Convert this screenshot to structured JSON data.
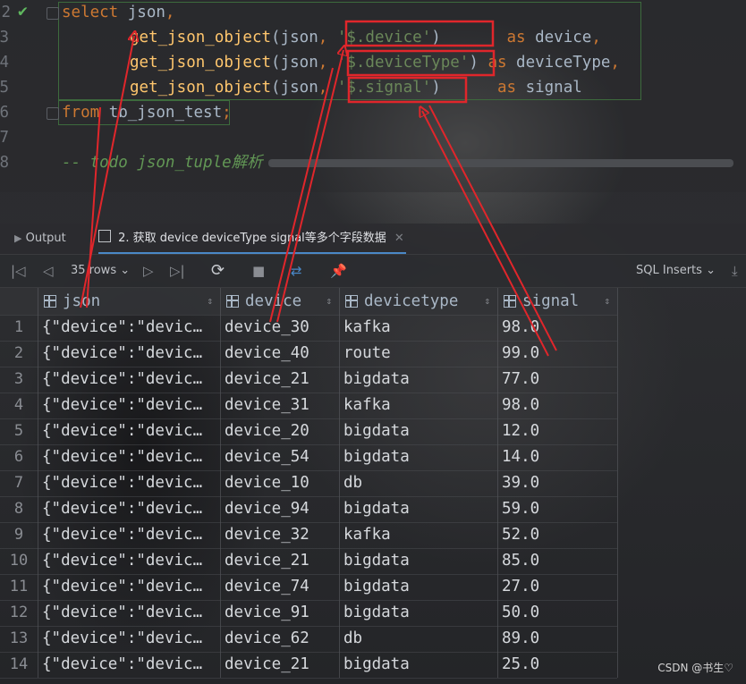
{
  "editor": {
    "lines": [
      {
        "num": "2",
        "tokens": [
          [
            "kw",
            "select "
          ],
          [
            "id",
            "json"
          ],
          [
            "kw",
            ","
          ]
        ]
      },
      {
        "num": "3",
        "tokens": [
          [
            "fn",
            "get_json_object"
          ],
          [
            "id",
            "("
          ],
          [
            "id",
            "json"
          ],
          [
            "kw",
            ", "
          ],
          [
            "str",
            "'$.device'"
          ],
          [
            "id",
            ")"
          ],
          [
            "id",
            "       "
          ],
          [
            "kw",
            "as "
          ],
          [
            "id",
            "device"
          ],
          [
            "kw",
            ","
          ]
        ]
      },
      {
        "num": "4",
        "tokens": [
          [
            "fn",
            "get_json_object"
          ],
          [
            "id",
            "("
          ],
          [
            "id",
            "json"
          ],
          [
            "kw",
            ", "
          ],
          [
            "str",
            "'$.deviceType'"
          ],
          [
            "id",
            ")"
          ],
          [
            "id",
            " "
          ],
          [
            "kw",
            "as "
          ],
          [
            "id",
            "deviceType"
          ],
          [
            "kw",
            ","
          ]
        ]
      },
      {
        "num": "5",
        "tokens": [
          [
            "fn",
            "get_json_object"
          ],
          [
            "id",
            "("
          ],
          [
            "id",
            "json"
          ],
          [
            "kw",
            ", "
          ],
          [
            "str",
            "'$.signal'"
          ],
          [
            "id",
            ")"
          ],
          [
            "id",
            "      "
          ],
          [
            "kw",
            "as "
          ],
          [
            "id",
            "signal"
          ]
        ]
      },
      {
        "num": "6",
        "tokens": [
          [
            "kw",
            "from "
          ],
          [
            "id",
            "tb_json_test"
          ],
          [
            "kw",
            ";"
          ]
        ]
      },
      {
        "num": "7",
        "tokens": []
      },
      {
        "num": "8",
        "tokens": [
          [
            "cm",
            "-- todo json_tuple解析"
          ]
        ]
      }
    ]
  },
  "tabs": {
    "output": "Output",
    "result": "2. 获取 device deviceType signal等多个字段数据"
  },
  "toolbar": {
    "rows": "35 rows",
    "export": "SQL Inserts"
  },
  "grid": {
    "columns": [
      "json",
      "device",
      "devicetype",
      "signal"
    ],
    "rows": [
      [
        "1",
        "{\"device\":\"devic…",
        "device_30",
        "kafka",
        "98.0"
      ],
      [
        "2",
        "{\"device\":\"devic…",
        "device_40",
        "route",
        "99.0"
      ],
      [
        "3",
        "{\"device\":\"devic…",
        "device_21",
        "bigdata",
        "77.0"
      ],
      [
        "4",
        "{\"device\":\"devic…",
        "device_31",
        "kafka",
        "98.0"
      ],
      [
        "5",
        "{\"device\":\"devic…",
        "device_20",
        "bigdata",
        "12.0"
      ],
      [
        "6",
        "{\"device\":\"devic…",
        "device_54",
        "bigdata",
        "14.0"
      ],
      [
        "7",
        "{\"device\":\"devic…",
        "device_10",
        "db",
        "39.0"
      ],
      [
        "8",
        "{\"device\":\"devic…",
        "device_94",
        "bigdata",
        "59.0"
      ],
      [
        "9",
        "{\"device\":\"devic…",
        "device_32",
        "kafka",
        "52.0"
      ],
      [
        "10",
        "{\"device\":\"devic…",
        "device_21",
        "bigdata",
        "85.0"
      ],
      [
        "11",
        "{\"device\":\"devic…",
        "device_74",
        "bigdata",
        "27.0"
      ],
      [
        "12",
        "{\"device\":\"devic…",
        "device_91",
        "bigdata",
        "50.0"
      ],
      [
        "13",
        "{\"device\":\"devic…",
        "device_62",
        "db",
        "89.0"
      ],
      [
        "14",
        "{\"device\":\"devic…",
        "device_21",
        "bigdata",
        "25.0"
      ]
    ]
  },
  "watermark": "CSDN @书生♡",
  "colors": {
    "annotation": "#e0262b",
    "accent": "#4a88c7"
  }
}
